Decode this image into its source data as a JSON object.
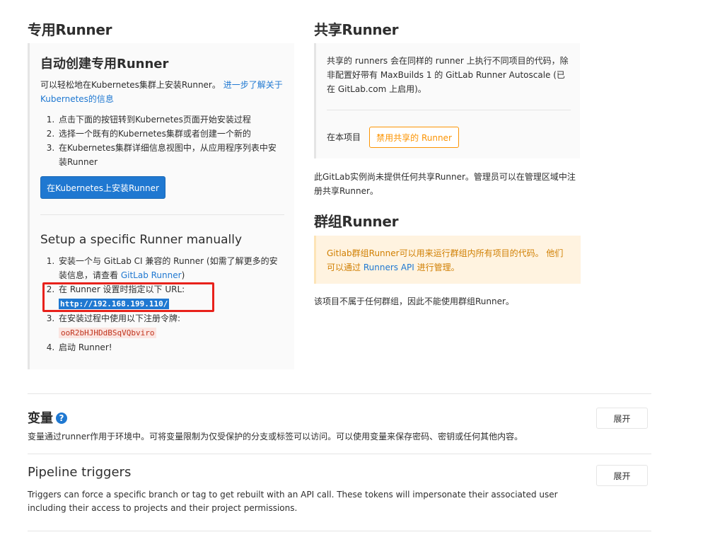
{
  "specific": {
    "title": "专用Runner",
    "auto": {
      "title": "自动创建专用Runner",
      "intro": "可以轻松地在Kubernetes集群上安装Runner。",
      "intro_link": "进一步了解关于Kubernetes的信息",
      "steps": [
        "点击下面的按钮转到Kubernetes页面开始安装过程",
        "选择一个既有的Kubernetes集群或者创建一个新的",
        "在Kubernetes集群详细信息视图中，从应用程序列表中安装Runner"
      ],
      "button": "在Kubernetes上安装Runner"
    },
    "manual": {
      "title": "Setup a specific Runner manually",
      "step1_text": "安装一个与 GitLab CI 兼容的 Runner (如需了解更多的安装信息，请查看 ",
      "step1_link": "GitLab Runner",
      "step1_end": ")",
      "step2_text": "在 Runner 设置时指定以下 URL:",
      "url": "http://192.168.199.110/",
      "step3_text": "在安装过程中使用以下注册令牌:",
      "token": "ooR2bHJHDdBSqVQbviro",
      "step4_text": "启动 Runner!"
    }
  },
  "shared": {
    "title": "共享Runner",
    "description": "共享的 runners 会在同样的 runner 上执行不同项目的代码，除非配置好带有 MaxBuilds 1 的 GitLab Runner Autoscale (已在 GitLab.com 上启用)。",
    "project_label": "在本项目",
    "disable_button": "禁用共享的 Runner",
    "none_notice": "此GitLab实例尚未提供任何共享Runner。管理员可以在管理区域中注册共享Runner。"
  },
  "group": {
    "title": "群组Runner",
    "warning_text": "Gitlab群组Runner可以用来运行群组内所有项目的代码。 他们可以通过 ",
    "warning_link": "Runners API",
    "warning_end": " 进行管理。",
    "not_in_group": "该项目不属于任何群组，因此不能使用群组Runner。"
  },
  "variables": {
    "title": "变量",
    "help_icon": "?",
    "description": "变量通过runner作用于环境中。可将变量限制为仅受保护的分支或标签可以访问。可以使用变量来保存密码、密钥或任何其他内容。",
    "expand_button": "展开"
  },
  "pipeline_triggers": {
    "title": "Pipeline triggers",
    "description": "Triggers can force a specific branch or tag to get rebuilt with an API call. These tokens will impersonate their associated user including their access to projects and their project permissions.",
    "expand_button": "展开"
  },
  "colors": {
    "primary": "#1f78d1",
    "warning": "#fc9403",
    "highlight_box": "#e8211b"
  }
}
